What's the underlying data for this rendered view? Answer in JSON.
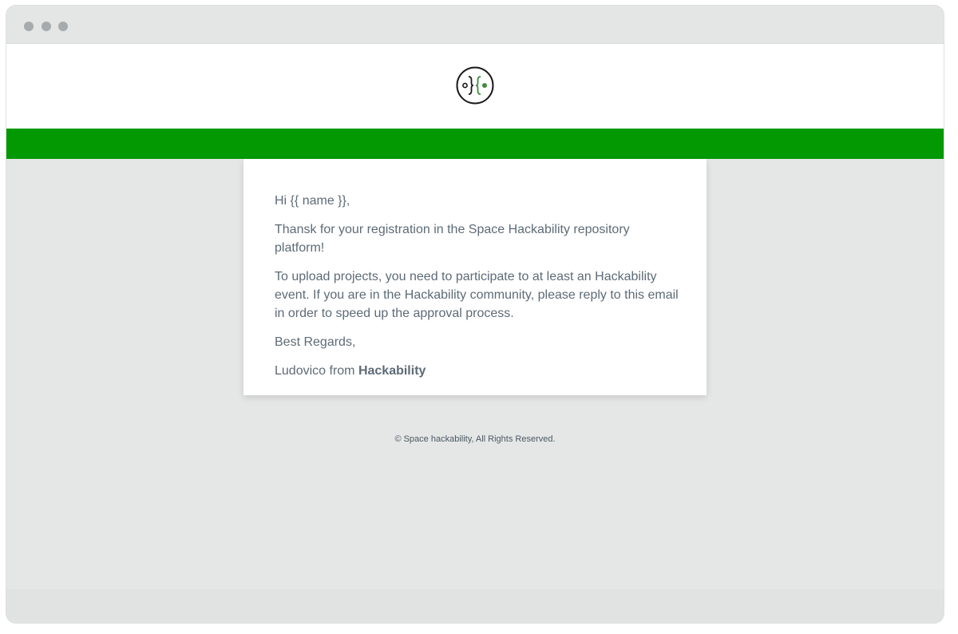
{
  "email": {
    "greeting": "Hi {{ name }},",
    "paragraph1": "Thansk for your registration in the Space Hackability repository platform!",
    "paragraph2": "To upload projects, you need to participate to at least an Hackability event. If you are in the Hackability community, please reply to this email in order to speed up the approval process.",
    "closing": "Best Regards,",
    "signature_prefix": "Ludovico from ",
    "signature_org": "Hackability"
  },
  "footer": {
    "copyright": "© Space hackability, All Rights Reserved."
  },
  "colors": {
    "brand_green": "#029902",
    "text": "#5d6b77",
    "background": "#e5e6e6"
  },
  "icons": {
    "logo": "hackability-logo-icon",
    "window_controls": [
      "window-dot",
      "window-dot",
      "window-dot"
    ]
  }
}
